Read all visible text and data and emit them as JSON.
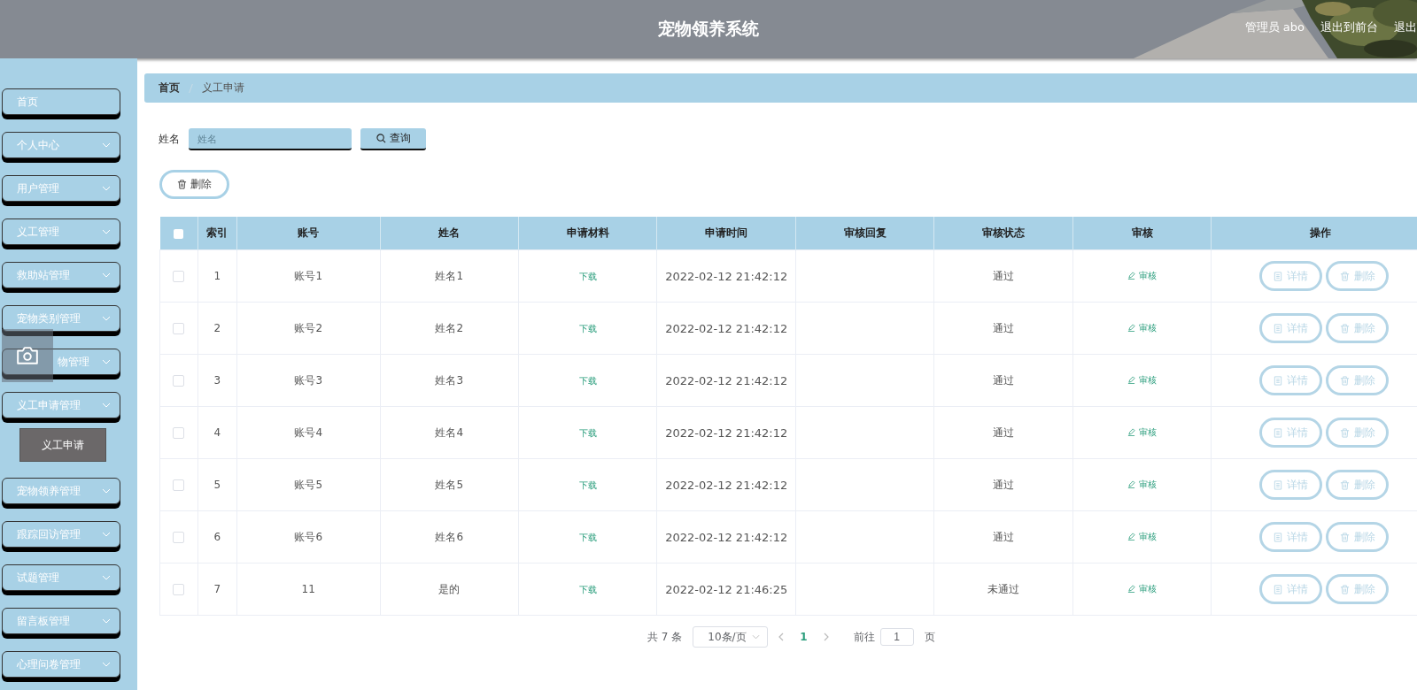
{
  "header": {
    "title": "宠物领养系统",
    "links": [
      "管理员 abo",
      "退出到前台",
      "退出"
    ]
  },
  "sidebar": {
    "items": [
      {
        "label": "首页",
        "kind": "link"
      },
      {
        "label": "个人中心",
        "kind": "menu"
      },
      {
        "label": "用户管理",
        "kind": "menu"
      },
      {
        "label": "义工管理",
        "kind": "menu"
      },
      {
        "label": "救助站管理",
        "kind": "menu"
      },
      {
        "label": "宠物类别管理",
        "kind": "menu"
      },
      {
        "label": "物管理",
        "kind": "covered"
      },
      {
        "label": "义工申请管理",
        "kind": "menu",
        "children": [
          {
            "label": "义工申请",
            "selected": true
          }
        ]
      },
      {
        "label": "宠物领养管理",
        "kind": "menu"
      },
      {
        "label": "跟踪回访管理",
        "kind": "menu"
      },
      {
        "label": "试题管理",
        "kind": "menu"
      },
      {
        "label": "留言板管理",
        "kind": "menu"
      },
      {
        "label": "心理问卷管理",
        "kind": "menu"
      }
    ]
  },
  "breadcrumb": [
    "首页",
    "义工申请"
  ],
  "search": {
    "label": "姓名",
    "placeholder": "姓名",
    "button": "查询"
  },
  "delete_button": "删除",
  "table": {
    "header_checked": false,
    "columns": [
      "索引",
      "账号",
      "姓名",
      "申请材料",
      "申请时间",
      "审核回复",
      "审核状态",
      "审核",
      "操作"
    ],
    "rows": [
      {
        "checked": false,
        "index": "1",
        "account": "账号1",
        "name": "姓名1",
        "material": "下载",
        "time": "2022-02-12 21:42:12",
        "status": "通过",
        "review": "审核",
        "actions": [
          "详情",
          "删除"
        ]
      },
      {
        "checked": false,
        "index": "2",
        "account": "账号2",
        "name": "姓名2",
        "material": "下载",
        "time": "2022-02-12 21:42:12",
        "status": "通过",
        "review": "审核",
        "actions": [
          "详情",
          "删除"
        ]
      },
      {
        "checked": false,
        "index": "3",
        "account": "账号3",
        "name": "姓名3",
        "material": "下载",
        "time": "2022-02-12 21:42:12",
        "status": "通过",
        "review": "审核",
        "actions": [
          "详情",
          "删除"
        ]
      },
      {
        "checked": false,
        "index": "4",
        "account": "账号4",
        "name": "姓名4",
        "material": "下载",
        "time": "2022-02-12 21:42:12",
        "status": "通过",
        "review": "审核",
        "actions": [
          "详情",
          "删除"
        ]
      },
      {
        "checked": false,
        "index": "5",
        "account": "账号5",
        "name": "姓名5",
        "material": "下载",
        "time": "2022-02-12 21:42:12",
        "status": "通过",
        "review": "审核",
        "actions": [
          "详情",
          "删除"
        ]
      },
      {
        "checked": false,
        "index": "6",
        "account": "账号6",
        "name": "姓名6",
        "material": "下载",
        "time": "2022-02-12 21:42:12",
        "status": "通过",
        "review": "审核",
        "actions": [
          "详情",
          "删除"
        ]
      },
      {
        "checked": false,
        "index": "7",
        "account": "11",
        "name": "是的",
        "material": "下载",
        "time": "2022-02-12 21:46:25",
        "status": "未通过",
        "review": "审核",
        "actions": [
          "详情",
          "删除"
        ]
      }
    ]
  },
  "pagination": {
    "total": "共 7 条",
    "page_size": "10条/页",
    "pages": [
      {
        "label": "1",
        "selected": true
      }
    ],
    "goto_label": "前往",
    "goto_value": "1",
    "goto_suffix": "页"
  }
}
